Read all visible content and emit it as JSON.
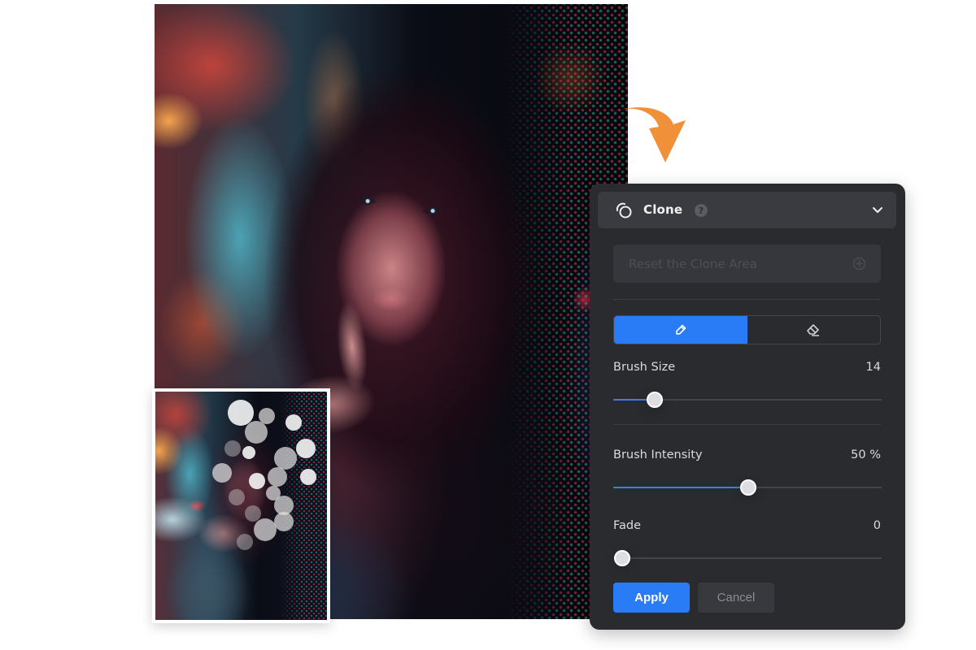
{
  "main_photo": {
    "description": "portrait of woman with finger on lips, neon bokeh background"
  },
  "thumbnail": {
    "description": "before image with white clone/bokeh spots",
    "spots_visible": true
  },
  "arrow": {
    "icon": "curved-arrow-icon",
    "color": "#f0913a"
  },
  "panel": {
    "header": {
      "icon": "clone-icon",
      "title": "Clone",
      "help_icon": "help-icon",
      "help_glyph": "?",
      "chevron": "chevron-down-icon"
    },
    "reset_button": {
      "label": "Reset the Clone Area",
      "icon": "crosshair-icon",
      "enabled": false
    },
    "tools": [
      {
        "name": "brush",
        "icon": "pencil-icon",
        "active": true
      },
      {
        "name": "eraser",
        "icon": "eraser-icon",
        "active": false
      }
    ],
    "sliders": [
      {
        "label": "Brush Size",
        "display": "14",
        "fraction": 0.15
      },
      {
        "label": "Brush Intensity",
        "display": "50 %",
        "fraction": 0.5
      },
      {
        "label": "Fade",
        "display": "0",
        "fraction": 0.0
      }
    ],
    "apply_label": "Apply",
    "cancel_label": "Cancel"
  },
  "colors": {
    "accent": "#2a7bf6",
    "panel_bg": "#2a2b2f",
    "header_bg": "#3a3b40",
    "arrow": "#f0913a"
  }
}
